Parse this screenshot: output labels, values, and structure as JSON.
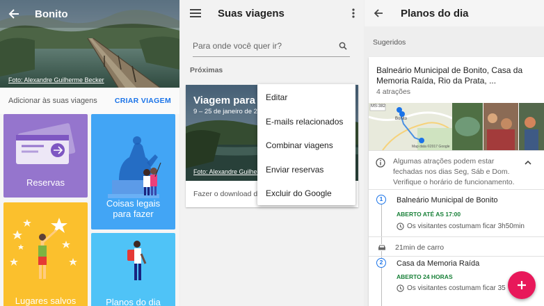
{
  "panel1": {
    "title": "Bonito",
    "photo_credit": "Foto: Alexandre Guilherme Becker",
    "add_label": "Adicionar às suas viagens",
    "create_trip": "CRIAR VIAGEM",
    "tiles": [
      {
        "label": "Reservas",
        "color": "#9575cd"
      },
      {
        "label": "Coisas legais para fazer",
        "color": "#42a5f5"
      },
      {
        "label": "Lugares salvos",
        "color": "#fbc02d"
      },
      {
        "label": "Planos do dia",
        "color": "#4fc3f7"
      }
    ]
  },
  "panel2": {
    "title": "Suas viagens",
    "search_placeholder": "Para onde você quer ir?",
    "section": "Próximas",
    "trip": {
      "title": "Viagem para B",
      "dates": "9 – 25 de janeiro de 2",
      "photo_credit": "Foto: Alexandre Guilherm",
      "download": "Fazer o download de"
    },
    "menu": [
      "Editar",
      "E-mails relacionados",
      "Combinar viagens",
      "Enviar reservas",
      "Excluir do Google"
    ]
  },
  "panel3": {
    "title": "Planos do dia",
    "section": "Sugeridos",
    "place_title": "Balneário Municipal de Bonito, Casa da Memoria Raída, Rio da Prata, ...",
    "attractions": "4 atrações",
    "map_labels": {
      "road": "MS-382",
      "town": "Bonito",
      "copyright": "Map data ©2017 Google"
    },
    "notice": "Algumas atrações podem estar fechadas nos dias Seg, Sáb e Dom. Verifique o horário de funcionamento.",
    "stops": [
      {
        "num": "1",
        "name": "Balneário Municipal de Bonito",
        "open": "ABERTO ATÉ AS 17:00",
        "visit": "Os visitantes costumam ficar 3h50min"
      },
      {
        "num": "2",
        "name": "Casa da Memoria Raída",
        "open": "ABERTO 24 HORAS",
        "visit": "Os visitantes costumam ficar 35"
      }
    ],
    "drive": "21min de carro",
    "accent": "#1a73e8",
    "fab_color": "#e8185a"
  }
}
